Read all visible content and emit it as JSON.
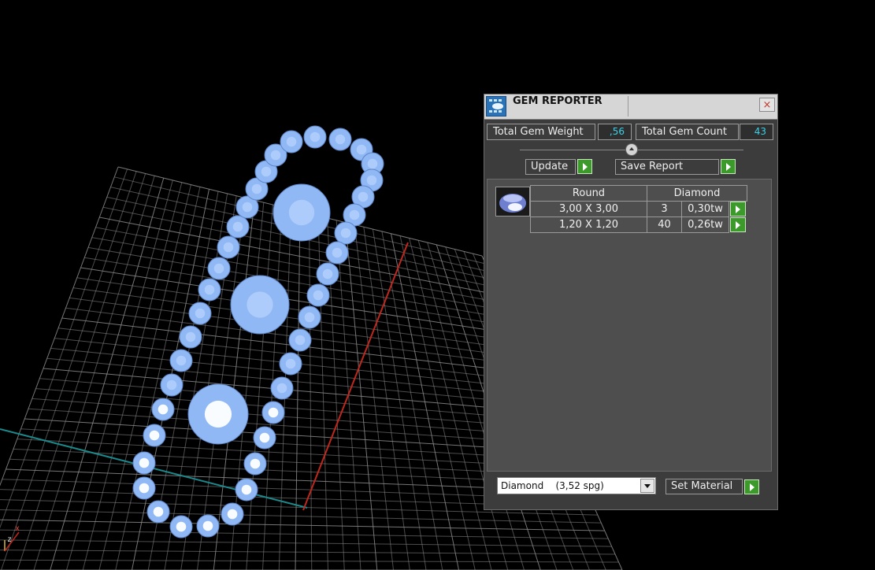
{
  "panel": {
    "title": "GEM REPORTER",
    "close_glyph": "×",
    "total_weight_label": "Total Gem Weight",
    "total_weight_value": ",56",
    "total_count_label": "Total Gem Count",
    "total_count_value": "43",
    "update_label": "Update",
    "save_report_label": "Save Report",
    "table": {
      "headers": [
        "Round",
        "Diamond"
      ],
      "rows": [
        {
          "size": "3,00 X 3,00",
          "count": "3",
          "weight": "0,30tw"
        },
        {
          "size": "1,20 X 1,20",
          "count": "40",
          "weight": "0,26tw"
        }
      ]
    },
    "material_value": "Diamond    (3,52 spg)",
    "set_material_label": "Set Material"
  },
  "viewport": {
    "axis_z": "z",
    "axis_x": "x"
  },
  "colors": {
    "gem": "#8fb8f5",
    "accent_value": "#3ad0e8",
    "play_button": "#3b9a2a",
    "grid": "#9a9a9a",
    "axis_red": "#c0281e",
    "axis_cyan": "#1a8a8c"
  },
  "icons": [
    "gem-reporter-icon",
    "close-icon",
    "play-icon",
    "dropdown-arrow-icon",
    "gem-thumbnail-icon"
  ]
}
